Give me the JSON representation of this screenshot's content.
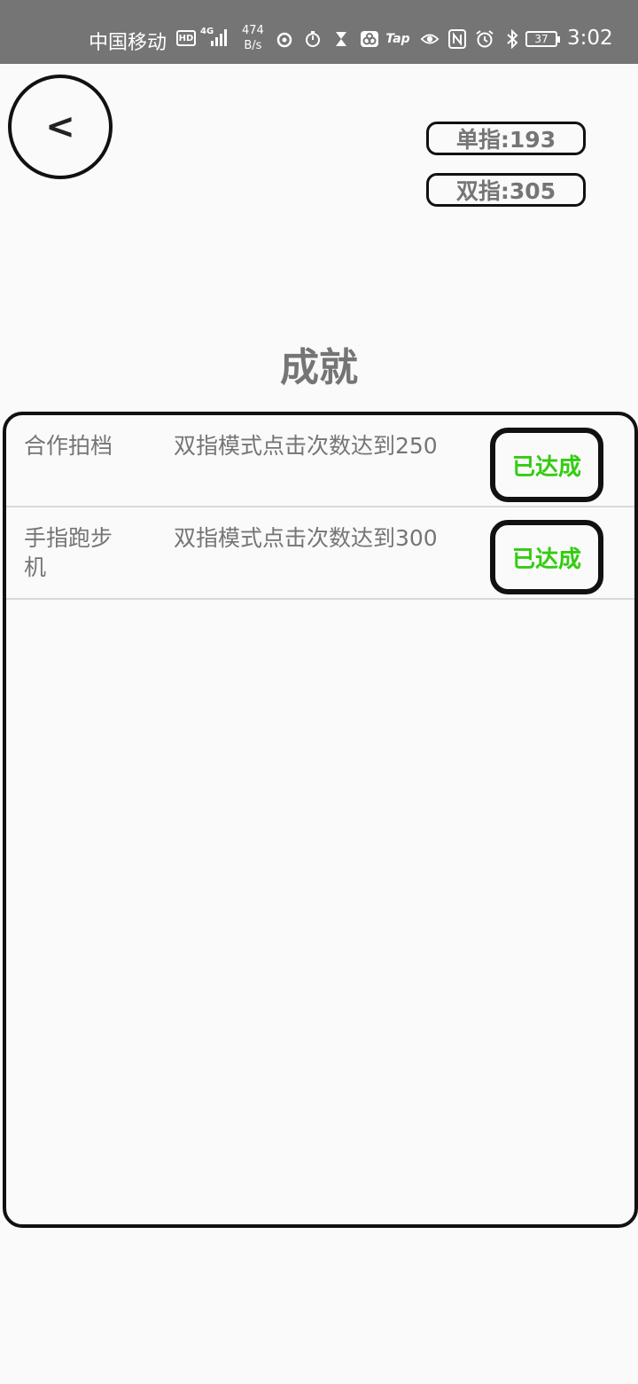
{
  "status_bar": {
    "carrier": "中国移动",
    "hd": "HD",
    "network": "4G",
    "speed_value": "474",
    "speed_unit": "B/s",
    "tap": "Tap",
    "battery": "37",
    "time": "3:02"
  },
  "header": {
    "back_label": "<",
    "single_finger": "单指:193",
    "double_finger": "双指:305"
  },
  "page": {
    "title": "成就"
  },
  "achievements": [
    {
      "name": "合作拍档",
      "description": "双指模式点击次数达到250",
      "status": "已达成"
    },
    {
      "name": "手指跑步机",
      "description": "双指模式点击次数达到300",
      "status": "已达成"
    }
  ],
  "colors": {
    "status_bar": "#757575",
    "text_gray": "#757575",
    "achieved_green": "#33cc11",
    "border": "#111111"
  },
  "icons": {
    "status_left": [
      "weibo-icon",
      "timer-icon",
      "hourglass-icon",
      "baidu-netdisk-icon"
    ],
    "status_right": [
      "eye-icon",
      "nfc-icon",
      "alarm-icon",
      "bluetooth-icon"
    ]
  }
}
